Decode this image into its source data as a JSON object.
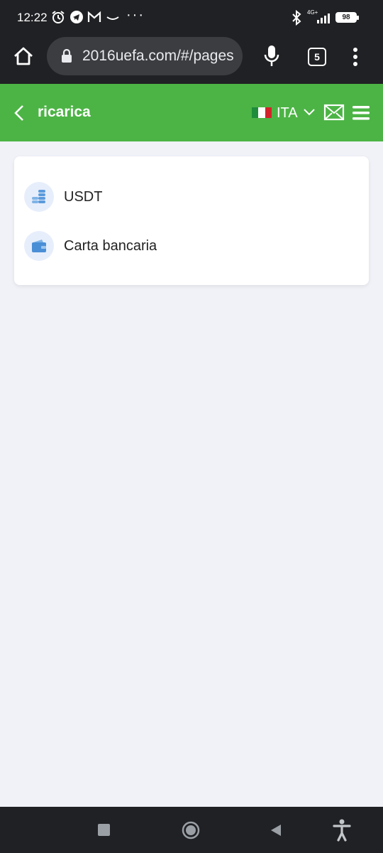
{
  "status_bar": {
    "time": "12:22",
    "network": "4G+",
    "battery": "98"
  },
  "browser": {
    "url": "2016uefa.com/#/pages",
    "tab_count": "5"
  },
  "header": {
    "title": "ricarica",
    "language": "ITA",
    "accent_color": "#4cb445"
  },
  "payment_methods": [
    {
      "label": "USDT",
      "icon": "coins-icon"
    },
    {
      "label": "Carta bancaria",
      "icon": "wallet-icon"
    }
  ]
}
